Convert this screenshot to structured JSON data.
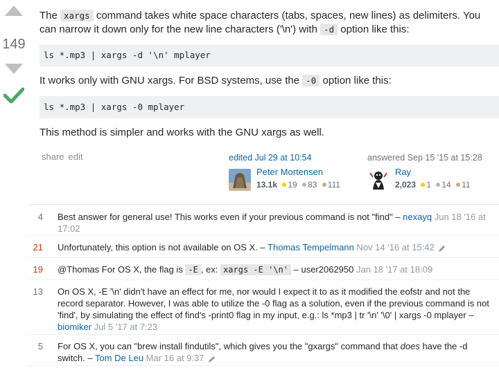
{
  "vote": {
    "count": "149"
  },
  "answer": {
    "p1": {
      "a": "The ",
      "code1": "xargs",
      "b": " command takes white space characters (tabs, spaces, new lines) as delimiters. You can narrow it down only for the new line characters ('\\n') with ",
      "code2": "-d",
      "c": " option like this:"
    },
    "pre1": "ls *.mp3 | xargs -d '\\n' mplayer",
    "p2": {
      "a": "It works only with GNU xargs. For BSD systems, use the ",
      "code": "-0",
      "b": " option like this:"
    },
    "pre2": "ls *.mp3 | xargs -0 mplayer",
    "p3": "This method is simpler and works with the GNU xargs as well."
  },
  "post_menu": {
    "share": "share",
    "edit": "edit"
  },
  "editor": {
    "action": "edited Jul 29 at 10:54",
    "name": "Peter Mortensen",
    "rep": "13.1k",
    "gold": "19",
    "silver": "83",
    "bronze": "111"
  },
  "author": {
    "action": "answered Sep 15 '15 at 15:28",
    "name": "Ray",
    "rep": "2,023",
    "gold": "1",
    "silver": "14",
    "bronze": "11"
  },
  "comments": [
    {
      "score": "4",
      "text": "Best answer for general use! This works even if your previous command is not \"find\" – ",
      "user": "nexayq",
      "date": "Jun 18 '16 at 17:02"
    },
    {
      "score": "21",
      "text": "Unfortunately, this option is not available on OS X. – ",
      "user": "Thomas Tempelmann",
      "date": "Nov 14 '16 at 15:42"
    },
    {
      "score": "19",
      "text_a": "@Thomas For OS X, the flag is ",
      "code1": "-E",
      "text_b": ", ex: ",
      "code2": "xargs -E '\\n'",
      "text_c": " – ",
      "user": "user2062950",
      "date": "Jan 18 '17 at 18:09"
    },
    {
      "score": "13",
      "text": "On OS X, -E '\\n' didn't have an effect for me, nor would I expect it to as it modified the eofstr and not the record separator. However, I was able to utilize the -0 flag as a solution, even if the previous command is not 'find', by simulating the effect of find's -print0 flag in my input, e.g.: ls *mp3 | tr '\\n' '\\0' | xargs -0 mplayer – ",
      "user": "biomiker",
      "date": "Jul 5 '17 at 7:23"
    },
    {
      "score": "5",
      "text_a": "For OS X, you can \"brew install findutils\", which gives you the \"gxargs\" command that ",
      "em": "does",
      "text_b": " have the -d switch. – ",
      "user": "Tom De Leu",
      "date": "Mar 16 at 9:37"
    }
  ]
}
